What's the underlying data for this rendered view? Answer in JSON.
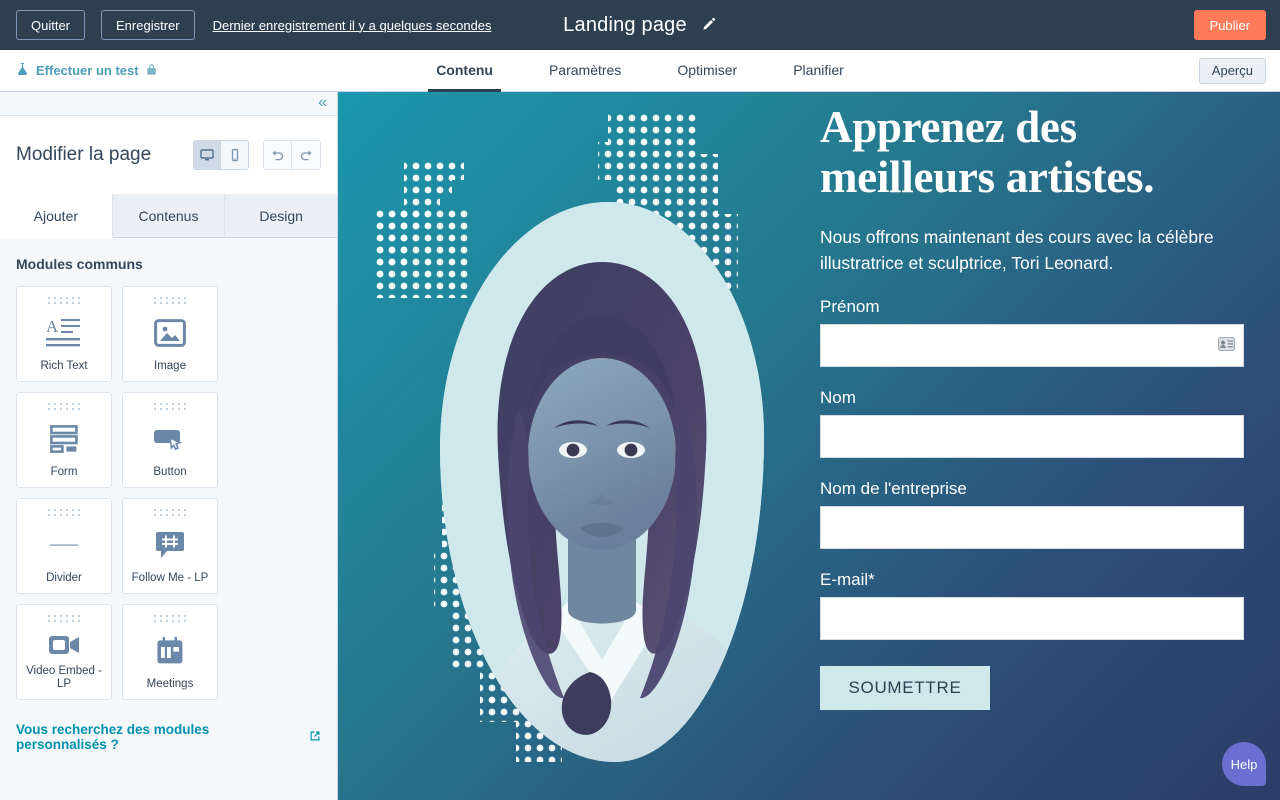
{
  "topbar": {
    "quit_label": "Quitter",
    "save_label": "Enregistrer",
    "save_status": "Dernier enregistrement il y a quelques secondes",
    "page_title": "Landing page",
    "edit_icon": "pencil-icon",
    "publish_label": "Publier",
    "publish_color": "#ff7a59",
    "background_color": "#2e3f50"
  },
  "navbar": {
    "ab_test_label": "Effectuer un test",
    "ab_test_icon": "flask-icon",
    "ab_test_lock_icon": "lock-icon",
    "ab_test_color": "#4d9fb8",
    "tabs": [
      {
        "label": "Contenu",
        "active": true
      },
      {
        "label": "Paramètres",
        "active": false
      },
      {
        "label": "Optimiser",
        "active": false
      },
      {
        "label": "Planifier",
        "active": false
      }
    ],
    "preview_label": "Aperçu"
  },
  "sidebar": {
    "collapse_icon": "chevron-double-left-icon",
    "title": "Modifier la page",
    "device_toggle": [
      {
        "name": "desktop-icon",
        "active": true
      },
      {
        "name": "mobile-icon",
        "active": false
      }
    ],
    "history": [
      {
        "name": "undo-icon"
      },
      {
        "name": "redo-icon"
      }
    ],
    "tabs": [
      {
        "label": "Ajouter",
        "active": true
      },
      {
        "label": "Contenus",
        "active": false
      },
      {
        "label": "Design",
        "active": false
      }
    ],
    "modules_heading": "Modules communs",
    "modules": [
      {
        "label": "Rich Text",
        "icon": "rich-text-icon"
      },
      {
        "label": "Image",
        "icon": "image-icon"
      },
      {
        "label": "Form",
        "icon": "form-icon"
      },
      {
        "label": "Button",
        "icon": "button-icon"
      },
      {
        "label": "Divider",
        "icon": "divider-icon"
      },
      {
        "label": "Follow Me - LP",
        "icon": "hashtag-bubble-icon"
      },
      {
        "label": "Video Embed - LP",
        "icon": "video-camera-icon"
      },
      {
        "label": "Meetings",
        "icon": "calendar-icon"
      }
    ],
    "custom_modules_link": "Vous recherchez des modules personnalisés ?",
    "custom_modules_icon": "external-link-icon"
  },
  "canvas": {
    "gradient_start": "#1c97ad",
    "gradient_end": "#2c3c68",
    "blob_color": "#cfe8ec",
    "hero_heading": "Apprenez des meilleurs artistes.",
    "hero_subheading": "Nous offrons maintenant des cours avec la célèbre illustratrice et sculptrice, Tori Leonard.",
    "form_fields": [
      {
        "label": "Prénom",
        "value": "",
        "placeholder": "",
        "has_autofill_icon": true
      },
      {
        "label": "Nom",
        "value": "",
        "placeholder": "",
        "has_autofill_icon": false
      },
      {
        "label": "Nom de l'entreprise",
        "value": "",
        "placeholder": "",
        "has_autofill_icon": false
      },
      {
        "label": "E-mail*",
        "value": "",
        "placeholder": "",
        "has_autofill_icon": false
      }
    ],
    "submit_label": "SOUMETTRE",
    "submit_color": "#cfe8ec"
  },
  "help": {
    "label": "Help",
    "color": "#6a6fd0"
  }
}
